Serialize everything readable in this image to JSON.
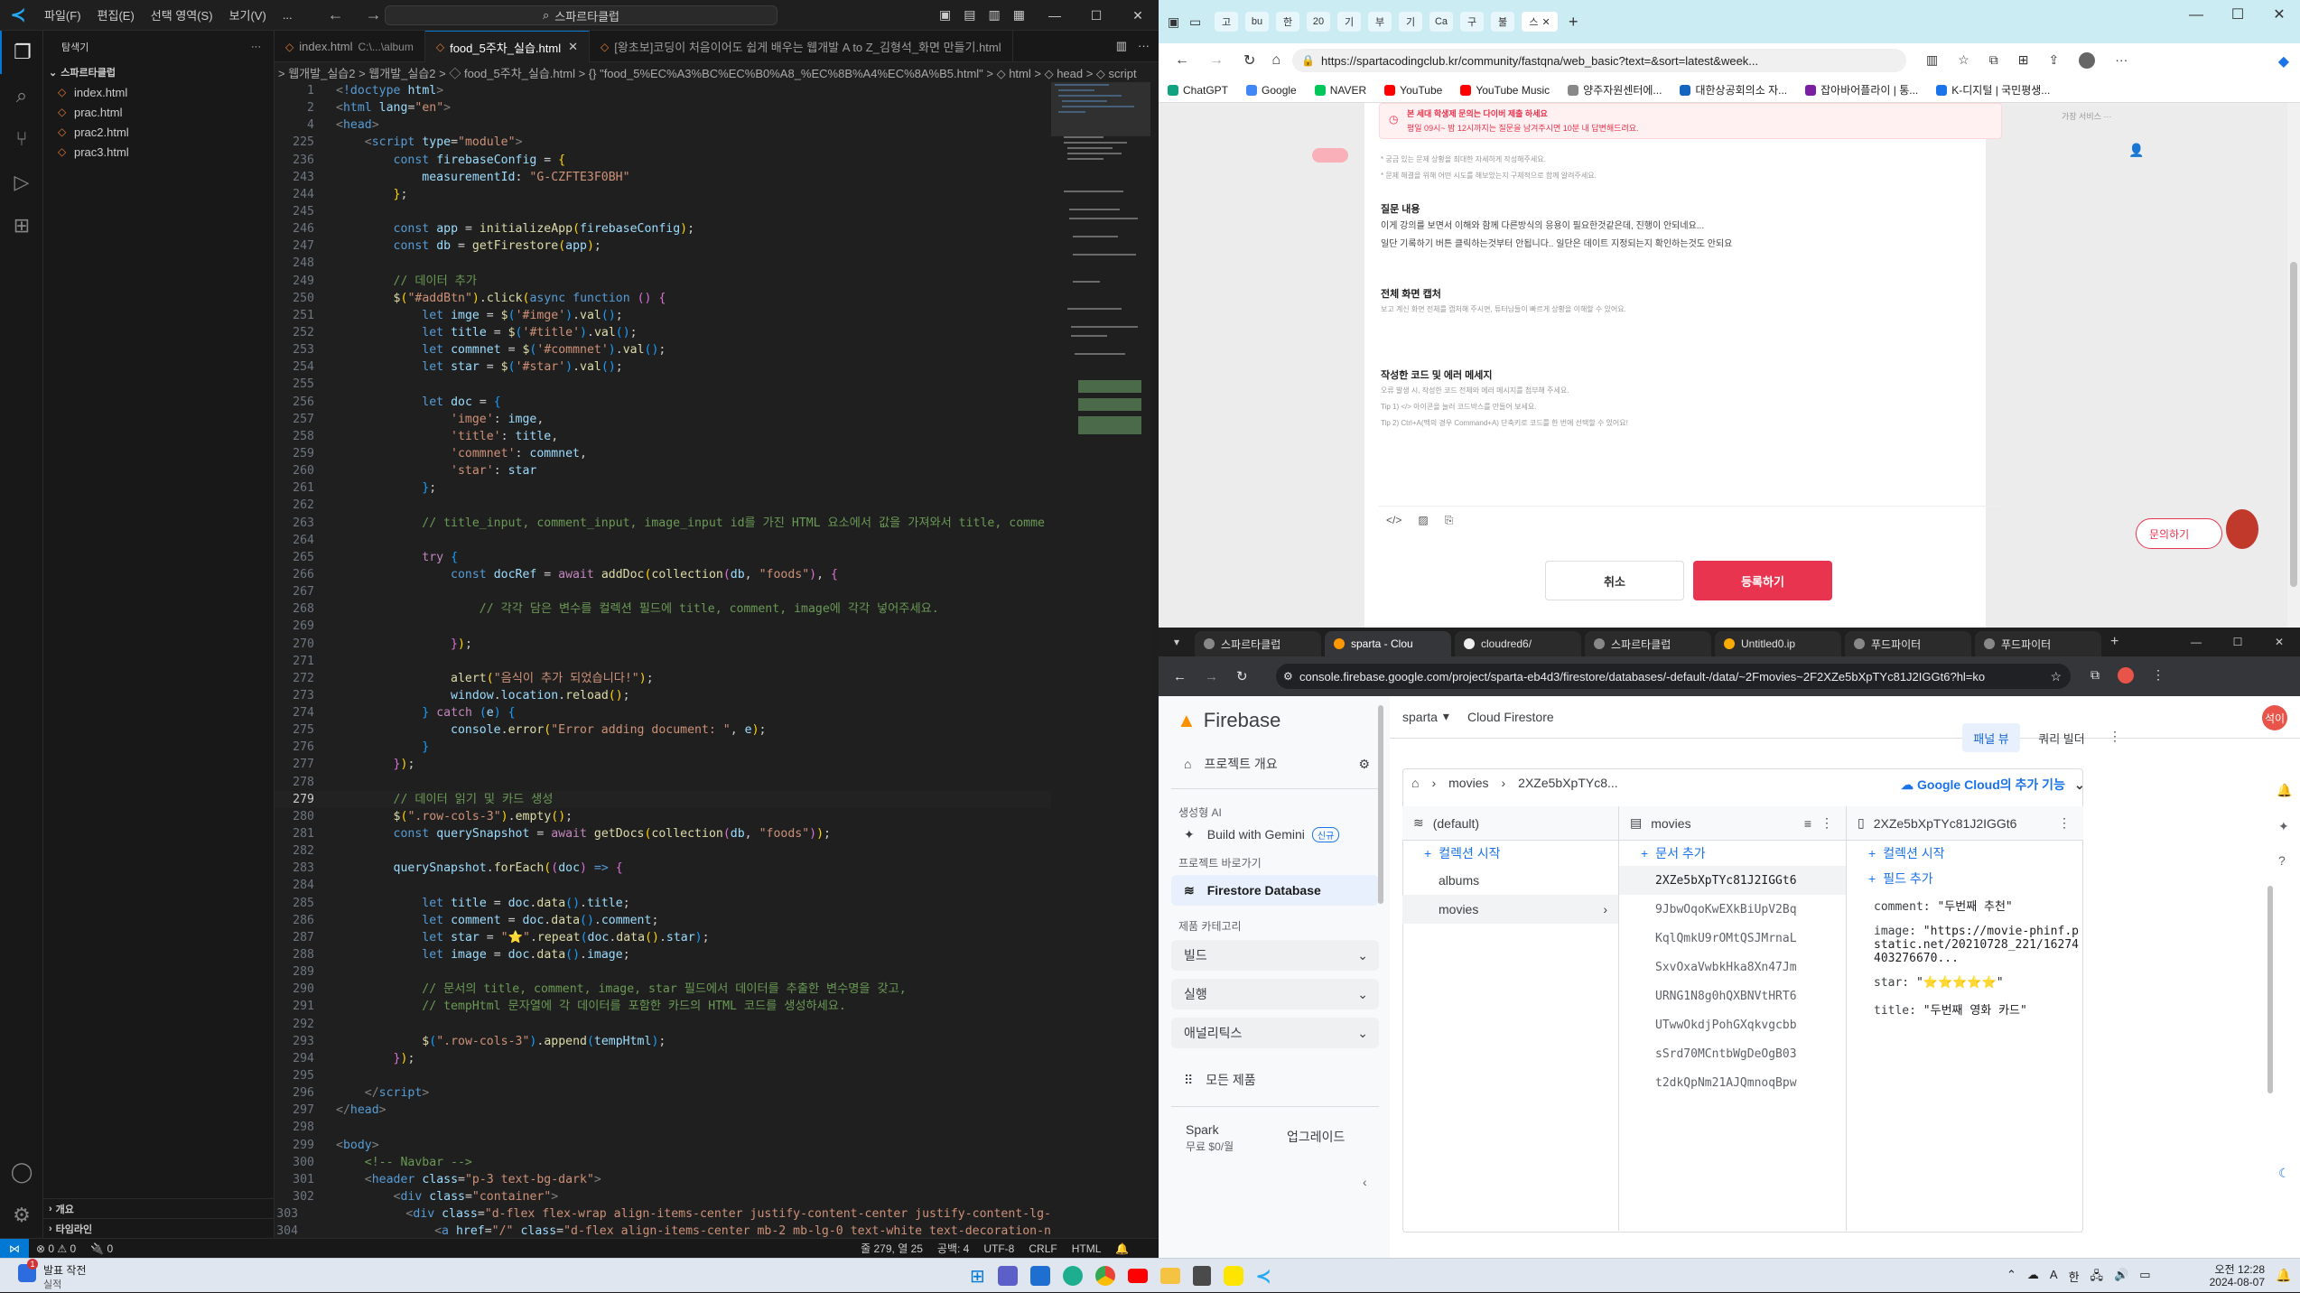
{
  "vscode": {
    "menu": [
      "파일(F)",
      "편집(E)",
      "선택 영역(S)",
      "보기(V)",
      "..."
    ],
    "command_center": "스파르타클럽",
    "explorer": {
      "title": "탐색기",
      "folder": "스파르타클럽",
      "files": [
        "index.html",
        "prac.html",
        "prac2.html",
        "prac3.html"
      ],
      "outline": "개요",
      "timeline": "타임라인"
    },
    "tabs": [
      {
        "label": "index.html",
        "sub": "C:\\...\\album",
        "active": false
      },
      {
        "label": "food_5주차_실습.html",
        "sub": "",
        "active": true
      },
      {
        "label": "[왕초보]코딩이 처음이어도 쉽게 배우는 웹개발 A to Z_김형석_화면 만들기.html",
        "sub": "",
        "active": false
      }
    ],
    "breadcrumb": "> 웹개발_실습2 > 웹개발_실습2 > ◇ food_5주차_실습.html > {} \"food_5%EC%A3%BC%EC%B0%A8_%EC%8B%A4%EC%8A%B5.html\" > ◇ html > ◇ head > ◇ script",
    "code_lines": [
      {
        "n": "1",
        "h": "<span class='p'>&lt;</span><span class='k'>!doctype</span> <span class='v'>html</span><span class='p'>&gt;</span>"
      },
      {
        "n": "2",
        "h": "<span class='p'>&lt;</span><span class='k'>html</span> <span class='v'>lang</span>=<span class='s'>\"en\"</span><span class='p'>&gt;</span>"
      },
      {
        "n": "4",
        "h": "<span class='p'>&lt;</span><span class='k'>head</span><span class='p'>&gt;</span>"
      },
      {
        "n": "225",
        "h": "    <span class='p'>&lt;</span><span class='k'>script</span> <span class='v'>type</span>=<span class='s'>\"module\"</span><span class='p'>&gt;</span>"
      },
      {
        "n": "236",
        "h": "        <span class='k'>const</span> <span class='v'>firebaseConfig</span> = <span class='y'>{</span>"
      },
      {
        "n": "243",
        "h": "            <span class='v'>measurementId</span>: <span class='s'>\"G-CZFTE3F0BH\"</span>"
      },
      {
        "n": "244",
        "h": "        <span class='y'>}</span>;"
      },
      {
        "n": "245",
        "h": ""
      },
      {
        "n": "246",
        "h": "        <span class='k'>const</span> <span class='v'>app</span> = <span class='f'>initializeApp</span><span class='y'>(</span><span class='v'>firebaseConfig</span><span class='y'>)</span>;"
      },
      {
        "n": "247",
        "h": "        <span class='k'>const</span> <span class='v'>db</span> = <span class='f'>getFirestore</span><span class='y'>(</span><span class='v'>app</span><span class='y'>)</span>;"
      },
      {
        "n": "248",
        "h": ""
      },
      {
        "n": "249",
        "h": "        <span class='c'>// 데이터 추가</span>"
      },
      {
        "n": "250",
        "h": "        <span class='f'>$</span><span class='y'>(</span><span class='s'>\"#addBtn\"</span><span class='y'>)</span>.<span class='f'>click</span><span class='y'>(</span><span class='k'>async</span> <span class='k'>function</span> <span class='g'>()</span> <span class='g'>{</span>"
      },
      {
        "n": "251",
        "h": "            <span class='k'>let</span> <span class='v'>imge</span> = <span class='f'>$</span><span class='b'>(</span><span class='s'>'#imge'</span><span class='b'>)</span>.<span class='f'>val</span><span class='b'>()</span>;"
      },
      {
        "n": "252",
        "h": "            <span class='k'>let</span> <span class='v'>title</span> = <span class='f'>$</span><span class='b'>(</span><span class='s'>'#title'</span><span class='b'>)</span>.<span class='f'>val</span><span class='b'>()</span>;"
      },
      {
        "n": "253",
        "h": "            <span class='k'>let</span> <span class='v'>commnet</span> = <span class='f'>$</span><span class='b'>(</span><span class='s'>'#commnet'</span><span class='b'>)</span>.<span class='f'>val</span><span class='b'>()</span>;"
      },
      {
        "n": "254",
        "h": "            <span class='k'>let</span> <span class='v'>star</span> = <span class='f'>$</span><span class='b'>(</span><span class='s'>'#star'</span><span class='b'>)</span>.<span class='f'>val</span><span class='b'>()</span>;"
      },
      {
        "n": "255",
        "h": ""
      },
      {
        "n": "256",
        "h": "            <span class='k'>let</span> <span class='v'>doc</span> = <span class='b'>{</span>"
      },
      {
        "n": "257",
        "h": "                <span class='s'>'imge'</span>: <span class='v'>imge</span>,"
      },
      {
        "n": "258",
        "h": "                <span class='s'>'title'</span>: <span class='v'>title</span>,"
      },
      {
        "n": "259",
        "h": "                <span class='s'>'commnet'</span>: <span class='v'>commnet</span>,"
      },
      {
        "n": "260",
        "h": "                <span class='s'>'star'</span>: <span class='v'>star</span>"
      },
      {
        "n": "261",
        "h": "            <span class='b'>}</span>;"
      },
      {
        "n": "262",
        "h": ""
      },
      {
        "n": "263",
        "h": "            <span class='c'>// title_input, comment_input, image_input id를 가진 HTML 요소에서 값을 가져와서 title, comme</span>"
      },
      {
        "n": "264",
        "h": ""
      },
      {
        "n": "265",
        "h": "            <span class='kc'>try</span> <span class='b'>{</span>"
      },
      {
        "n": "266",
        "h": "                <span class='k'>const</span> <span class='v'>docRef</span> = <span class='kc'>await</span> <span class='f'>addDoc</span><span class='y'>(</span><span class='f'>collection</span><span class='g'>(</span><span class='v'>db</span>, <span class='s'>\"foods\"</span><span class='g'>)</span>, <span class='g'>{</span>"
      },
      {
        "n": "267",
        "h": ""
      },
      {
        "n": "268",
        "h": "                    <span class='c'>// 각각 담은 변수를 컬렉션 필드에 title, comment, image에 각각 넣어주세요.</span>"
      },
      {
        "n": "269",
        "h": ""
      },
      {
        "n": "270",
        "h": "                <span class='g'>}</span><span class='y'>)</span>;"
      },
      {
        "n": "271",
        "h": ""
      },
      {
        "n": "272",
        "h": "                <span class='f'>alert</span><span class='y'>(</span><span class='s'>\"음식이 추가 되었습니다!\"</span><span class='y'>)</span>;"
      },
      {
        "n": "273",
        "h": "                <span class='v'>window</span>.<span class='v'>location</span>.<span class='f'>reload</span><span class='y'>()</span>;"
      },
      {
        "n": "274",
        "h": "            <span class='b'>}</span> <span class='kc'>catch</span> <span class='b'>(</span><span class='v'>e</span><span class='b'>)</span> <span class='b'>{</span>"
      },
      {
        "n": "275",
        "h": "                <span class='v'>console</span>.<span class='f'>error</span><span class='y'>(</span><span class='s'>\"Error adding document: \"</span>, <span class='v'>e</span><span class='y'>)</span>;"
      },
      {
        "n": "276",
        "h": "            <span class='b'>}</span>"
      },
      {
        "n": "277",
        "h": "        <span class='g'>}</span><span class='y'>)</span>;"
      },
      {
        "n": "278",
        "h": ""
      },
      {
        "n": "279",
        "h": "        <span class='c'>// 데이터 읽기 및 카드 생성</span>",
        "cur": true
      },
      {
        "n": "280",
        "h": "        <span class='f'>$</span><span class='y'>(</span><span class='s'>\".row-cols-3\"</span><span class='y'>)</span>.<span class='f'>empty</span><span class='y'>()</span>;"
      },
      {
        "n": "281",
        "h": "        <span class='k'>const</span> <span class='v'>querySnapshot</span> = <span class='kc'>await</span> <span class='f'>getDocs</span><span class='y'>(</span><span class='f'>collection</span><span class='g'>(</span><span class='v'>db</span>, <span class='s'>\"foods\"</span><span class='g'>)</span><span class='y'>)</span>;"
      },
      {
        "n": "282",
        "h": ""
      },
      {
        "n": "283",
        "h": "        <span class='v'>querySnapshot</span>.<span class='f'>forEach</span><span class='y'>(</span><span class='g'>(</span><span class='v'>doc</span><span class='g'>)</span> <span class='k'>=&gt;</span> <span class='g'>{</span>"
      },
      {
        "n": "284",
        "h": ""
      },
      {
        "n": "285",
        "h": "            <span class='k'>let</span> <span class='v'>title</span> = <span class='v'>doc</span>.<span class='f'>data</span><span class='b'>()</span>.<span class='v'>title</span>;"
      },
      {
        "n": "286",
        "h": "            <span class='k'>let</span> <span class='v'>comment</span> = <span class='v'>doc</span>.<span class='f'>data</span><span class='b'>()</span>.<span class='v'>comment</span>;"
      },
      {
        "n": "287",
        "h": "            <span class='k'>let</span> <span class='v'>star</span> = <span class='s'>\"⭐\"</span>.<span class='f'>repeat</span><span class='b'>(</span><span class='v'>doc</span>.<span class='f'>data</span><span class='y'>()</span>.<span class='v'>star</span><span class='b'>)</span>;"
      },
      {
        "n": "288",
        "h": "            <span class='k'>let</span> <span class='v'>image</span> = <span class='v'>doc</span>.<span class='f'>data</span><span class='b'>()</span>.<span class='v'>image</span>;"
      },
      {
        "n": "289",
        "h": ""
      },
      {
        "n": "290",
        "h": "            <span class='c'>// 문서의 title, comment, image, star 필드에서 데이터를 추출한 변수명을 갖고,</span>"
      },
      {
        "n": "291",
        "h": "            <span class='c'>// tempHtml 문자열에 각 데이터를 포함한 카드의 HTML 코드를 생성하세요.</span>"
      },
      {
        "n": "292",
        "h": ""
      },
      {
        "n": "293",
        "h": "            <span class='f'>$</span><span class='b'>(</span><span class='s'>\".row-cols-3\"</span><span class='b'>)</span>.<span class='f'>append</span><span class='b'>(</span><span class='v'>tempHtml</span><span class='b'>)</span>;"
      },
      {
        "n": "294",
        "h": "        <span class='g'>}</span><span class='y'>)</span>;"
      },
      {
        "n": "295",
        "h": ""
      },
      {
        "n": "296",
        "h": "    <span class='p'>&lt;/</span><span class='k'>script</span><span class='p'>&gt;</span>"
      },
      {
        "n": "297",
        "h": "<span class='p'>&lt;/</span><span class='k'>head</span><span class='p'>&gt;</span>"
      },
      {
        "n": "298",
        "h": ""
      },
      {
        "n": "299",
        "h": "<span class='p'>&lt;</span><span class='k'>body</span><span class='p'>&gt;</span>"
      },
      {
        "n": "300",
        "h": "    <span class='c'>&lt;!-- Navbar --&gt;</span>"
      },
      {
        "n": "301",
        "h": "    <span class='p'>&lt;</span><span class='k'>header</span> <span class='v'>class</span>=<span class='s'>\"p-3 text-bg-dark\"</span><span class='p'>&gt;</span>"
      },
      {
        "n": "302",
        "h": "        <span class='p'>&lt;</span><span class='k'>div</span> <span class='v'>class</span>=<span class='s'>\"container\"</span><span class='p'>&gt;</span>"
      },
      {
        "n": "303",
        "h": "            <span class='p'>&lt;</span><span class='k'>div</span> <span class='v'>class</span>=<span class='s'>\"d-flex flex-wrap align-items-center justify-content-center justify-content-lg-</span>"
      },
      {
        "n": "304",
        "h": "                <span class='p'>&lt;</span><span class='k'>a</span> <span class='v'>href</span>=<span class='s'>\"/\"</span> <span class='v'>class</span>=<span class='s'>\"d-flex align-items-center mb-2 mb-lg-0 text-white text-decoration-n</span>"
      }
    ],
    "status": {
      "errors": "⊗ 0 ⚠ 0",
      "ports": "🔌 0",
      "position": "줄 279, 열 25",
      "spaces": "공백: 4",
      "encoding": "UTF-8",
      "eol": "CRLF",
      "language": "HTML"
    }
  },
  "edge": {
    "tab_labels": [
      "고",
      "bu",
      "한",
      "20",
      "기",
      "부",
      "기",
      "Ca",
      "구",
      "불",
      "스"
    ],
    "url": "https://spartacodingclub.kr/community/fastqna/web_basic?text=&sort=latest&week...",
    "bookmarks": [
      "ChatGPT",
      "Google",
      "NAVER",
      "YouTube",
      "YouTube Music",
      "양주자원센터에...",
      "대한상공회의소 자...",
      "잡아바어플라이 | 통...",
      "K-디지털 | 국민평생..."
    ],
    "bookmark_colors": [
      "#10a37f",
      "#4285f4",
      "#03c75a",
      "#ff0000",
      "#ff0000",
      "#888888",
      "#1565c0",
      "#7b1fa2",
      "#1a73e8"
    ],
    "page": {
      "notice_line1": "본 세대 학생제 문의는 다이버 제출 하세요",
      "notice_line2": "평일 09시~ 밤 12시까지는 질문을 남겨주시면 10분 내 답변해드려요.",
      "side_label": "가장 서비스 ···",
      "tip1": "* 궁금 있는 문제 상황을 최대한 자세하게 작성해주세요.",
      "tip2": "* 문제 해결을 위해 어떤 시도를 해보았는지 구체적으로 함께 알려주세요.",
      "q_title": "질문 내용",
      "q_body1": "이게 강의를 보면서 이해와 함께 다른방식의 응용이 필요한것같은데, 진행이 안되네요...",
      "q_body2": "일단 기록하기 버튼 클릭하는것부터 안됩니다.. 일단은 데이트 지정되는지 확인하는것도 안되요",
      "shot_title": "전체 화면 캡처",
      "shot_desc": "보고 계신 화면 전체를 캡처해 주시면, 튜터님들이 빠르게 상황을 이해할 수 있어요.",
      "code_title": "작성한 코드 및 에러 메세지",
      "code_desc1": "오류 발생 시, 작성한 코드 전체와 에러 메시지를 첨부해 주세요.",
      "code_desc2": "Tip 1) </> 아이콘을 눌러 코드박스를 만들어 보세요.",
      "code_desc3": "Tip 2) Ctrl+A(맥의 경우 Command+A) 단축키로 코드를 한 번에 선택할 수 있어요!",
      "cancel": "취소",
      "submit": "등록하기",
      "ask": "문의하기"
    }
  },
  "chrome": {
    "tabs": [
      "스파르타클럽",
      "sparta - Clou",
      "cloudred6/",
      "스파르타클럽",
      "Untitled0.ip",
      "푸드파이터",
      "푸드파이터"
    ],
    "url": "console.firebase.google.com/project/sparta-eb4d3/firestore/databases/-default-/data/~2Fmovies~2F2XZe5bXpTYc81J2IGGt6?hl=ko",
    "firebase": {
      "brand": "Firebase",
      "project": "sparta",
      "product": "Cloud Firestore",
      "overview": "프로젝트 개요",
      "gen_ai": "생성형 AI",
      "gemini": "Build with Gemini",
      "gemini_badge": "신규",
      "shortcuts": "프로젝트 바로가기",
      "firestore": "Firestore Database",
      "categories": "제품 카테고리",
      "build": "빌드",
      "run": "실행",
      "analytics": "애널리틱스",
      "all_products": "모든 제품",
      "plan_name": "Spark",
      "plan_desc": "무료 $0/월",
      "upgrade": "업그레이드",
      "panel_view": "패널 뷰",
      "query_builder": "쿼리 빌더",
      "path_collection": "movies",
      "path_doc": "2XZe5bXpTYc8...",
      "gcloud": "Google Cloud의 추가 기능",
      "col1_header": "(default)",
      "col2_header": "movies",
      "col3_header": "2XZe5bXpTYc81J2IGGt6",
      "start_collection": "컬렉션 시작",
      "add_document": "문서 추가",
      "add_field": "필드 추가",
      "collections": [
        "albums",
        "movies"
      ],
      "documents": [
        "2XZe5bXpTYc81J2IGGt6",
        "9JbwOqoKwEXkBiUpV2Bq",
        "KqlQmkU9rOMtQSJMrnaL",
        "SxvOxaVwbkHka8Xn47Jm",
        "URNG1N8g0hQXBNVtHRT6",
        "UTwwOkdjPohGXqkvgcbb",
        "sSrd70MCntbWgDeOgB03",
        "t2dkQpNm21AJQmnoqBpw"
      ],
      "fields": [
        {
          "key": "comment",
          "value": "\"두번째 추천\""
        },
        {
          "key": "image",
          "value": "\"https://movie-phinf.pstatic.net/20210728_221/16274403276670..."
        },
        {
          "key": "star",
          "value": "\"⭐⭐⭐⭐⭐\""
        },
        {
          "key": "title",
          "value": "\"두번째 영화 카드\""
        }
      ]
    }
  },
  "taskbar": {
    "notif_title": "발표 작전",
    "notif_sub": "실적",
    "notif_badge": "1",
    "time": "오전 12:28",
    "date": "2024-08-07",
    "ime": "한"
  }
}
